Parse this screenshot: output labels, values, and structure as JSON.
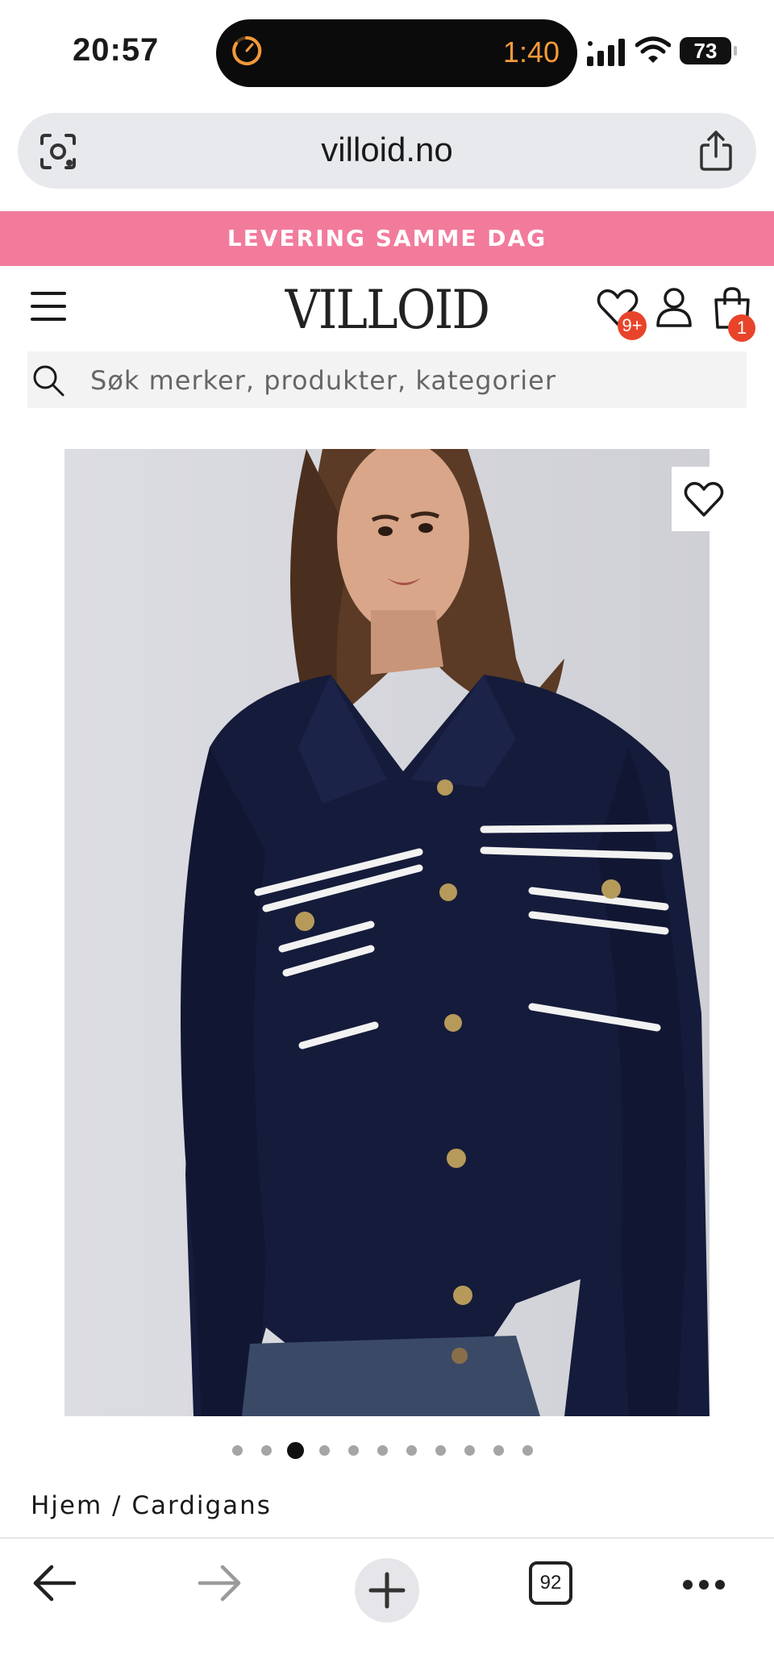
{
  "status_bar": {
    "time": "20:57",
    "timer": "1:40",
    "battery": "73"
  },
  "browser": {
    "url": "villoid.no",
    "open_tabs_count": "92"
  },
  "promo_banner": {
    "text": "LEVERING SAMME DAG",
    "color": "#f27b9c"
  },
  "header": {
    "logo": "VILLOID",
    "wishlist_badge": "9+",
    "cart_badge": "1",
    "badge_color": "#e8442a"
  },
  "search": {
    "placeholder": "Søk merker, produkter, kategorier"
  },
  "product": {
    "image_alt": "Navy knit cardigan with white stripes and gold buttons",
    "gallery_count": 11,
    "gallery_active_index": 2
  },
  "breadcrumb": {
    "text": "Hjem / Cardigans"
  },
  "icons": {
    "lens": "camera-lens-icon",
    "share": "share-icon",
    "menu": "hamburger-icon",
    "wishlist": "heart-icon",
    "account": "user-icon",
    "cart": "shopping-bag-icon",
    "search": "search-icon",
    "back": "arrow-left-icon",
    "forward": "arrow-right-icon",
    "new_tab": "plus-icon",
    "more": "ellipsis-icon"
  }
}
